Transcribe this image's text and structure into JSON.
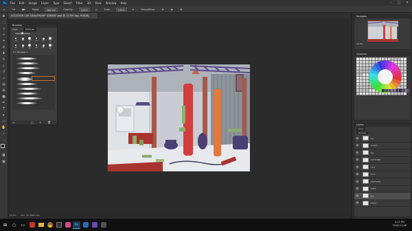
{
  "app": {
    "logo_text": "Ps",
    "menu": [
      "File",
      "Edit",
      "Image",
      "Layer",
      "Type",
      "Select",
      "Filter",
      "3D",
      "View",
      "Window",
      "Help"
    ]
  },
  "options_bar": {
    "mode_label": "Mode:",
    "mode_value": "Normal",
    "opacity_label": "Opacity:",
    "opacity_value": "100%",
    "flow_label": "Flow:",
    "flow_value": "100%",
    "smoothing_label": "Smoothing:"
  },
  "document": {
    "tab_title": "LOCATION CAR DEALERSHIP GARAGE.psd @ 12.5% (bg, RGB/8)"
  },
  "brush_panel": {
    "title": "Brushes",
    "size_label": "Size:",
    "size_value": "1000 px",
    "preset_sizes": [
      "30",
      "30",
      "30",
      "25",
      "25",
      "25",
      "36",
      "25",
      "36",
      "36",
      "36",
      "32"
    ],
    "folder_name": "Brushes 1"
  },
  "navigator": {
    "title": "Navigator",
    "zoom": "12.5%"
  },
  "swatches": {
    "title": "Swatches"
  },
  "layers": {
    "title": "Layers",
    "kind_label": "Kind",
    "blend_mode": "Normal",
    "rows": [
      {
        "name": "bg",
        "active": false
      },
      {
        "name": "lineart",
        "active": false
      },
      {
        "name": "bg",
        "active": false
      },
      {
        "name": "old TONE",
        "active": false
      },
      {
        "name": "cars",
        "active": false
      },
      {
        "name": "floor",
        "active": false
      },
      {
        "name": "elements",
        "active": false
      },
      {
        "name": "walls",
        "active": false
      },
      {
        "name": "bg",
        "active": true
      },
      {
        "name": "Layer",
        "active": false
      }
    ]
  },
  "status": {
    "zoom": "12.5%",
    "doc": "Doc: 91.3M/1.73G"
  },
  "taskbar": {
    "time": "4:12 PM",
    "date": "2018-11-08"
  },
  "colors": {
    "accent": "#c0733c",
    "canvas_bg": "#2b2b2b",
    "panel_bg": "#3a3a3a"
  }
}
